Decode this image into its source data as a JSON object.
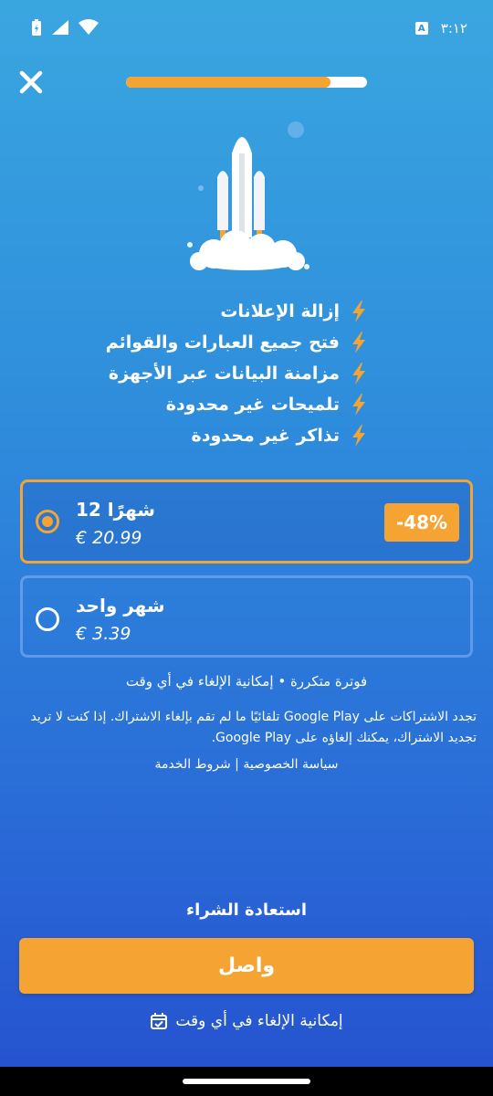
{
  "status_bar": {
    "time": "٣:١٢",
    "icons": [
      "battery-icon",
      "signal-icon",
      "wifi-icon",
      "accessibility-icon"
    ],
    "a_badge": "A"
  },
  "progress": {
    "value": 0.85
  },
  "features": [
    "إزالة الإعلانات",
    "فتح جميع العبارات والقوائم",
    "مزامنة البيانات عبر الأجهزة",
    "تلميحات غير محدودة",
    "تذاكر غير محدودة"
  ],
  "plans": [
    {
      "title": "12 شهرًا",
      "price": "€ 20.99",
      "discount": "-48%",
      "selected": true
    },
    {
      "title": "شهر واحد",
      "price": "€ 3.39",
      "selected": false
    }
  ],
  "billing_note": "فوترة متكررة • إمكانية الإلغاء في أي وقت",
  "renew_note": "تجدد الاشتراكات على Google Play تلقائيًا ما لم تقم بإلغاء الاشتراك. إذا كنت لا تريد تجديد الاشتراك، يمكنك إلغاؤه على Google Play.",
  "links": {
    "privacy": "سياسة الخصوصية",
    "separator": " | ",
    "terms": "شروط الخدمة"
  },
  "restore_label": "استعادة الشراء",
  "continue_label": "واصل",
  "cancel_anytime": "إمكانية الإلغاء في أي وقت",
  "colors": {
    "accent": "#f5a433",
    "bg_top": "#3aa6e0",
    "bg_bottom": "#2551cf"
  }
}
